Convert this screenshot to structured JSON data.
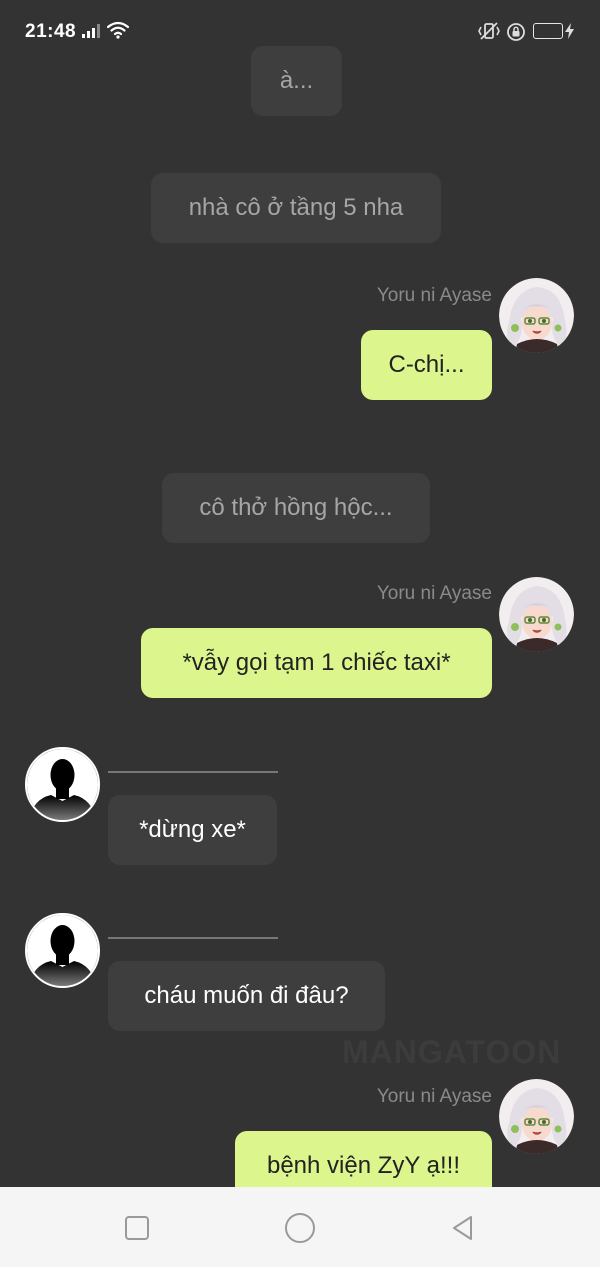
{
  "status_bar": {
    "time": "21:48",
    "battery": "76",
    "battery_level": 0.76
  },
  "messages": [
    {
      "kind": "narration",
      "text": "à..."
    },
    {
      "kind": "narration",
      "text": "nhà cô ở tầng 5 nha"
    },
    {
      "kind": "me",
      "sender": "Yoru ni Ayase",
      "text": "C-chị..."
    },
    {
      "kind": "narration",
      "text": "cô thở hồng hộc..."
    },
    {
      "kind": "me",
      "sender": "Yoru ni Ayase",
      "text": "*vẫy gọi tạm 1 chiếc taxi*"
    },
    {
      "kind": "other",
      "text": "*dừng xe*"
    },
    {
      "kind": "other",
      "text": "cháu muốn đi đâu?"
    },
    {
      "kind": "me",
      "sender": "Yoru ni Ayase",
      "text": "bệnh viện ZyY ạ!!!"
    }
  ],
  "watermark": "MANGATOON",
  "colors": {
    "background": "#333333",
    "my_bubble": "#dcf58c",
    "other_bubble": "#3e3e3e",
    "nav_bar": "#f5f5f5"
  },
  "nav_bar": {
    "icons": [
      "recent-apps-icon",
      "home-icon",
      "back-icon"
    ]
  }
}
